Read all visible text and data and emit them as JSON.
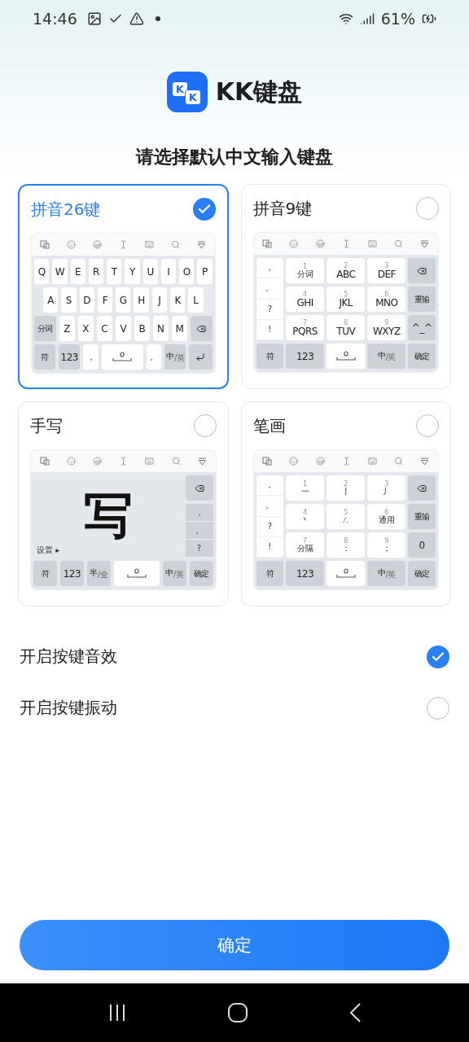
{
  "status_bar": {
    "time": "14:46",
    "battery": "61%"
  },
  "brand": {
    "logo_letters": [
      "K",
      "K"
    ],
    "name": "KK键盘"
  },
  "heading": "请选择默认中文输入键盘",
  "keyboards": [
    {
      "title": "拼音26键",
      "selected": true,
      "kind": "qwerty",
      "key_rows": [
        {
          "keys": [
            {
              "kind": "letter",
              "label": "Q"
            },
            {
              "kind": "letter",
              "label": "W"
            },
            {
              "kind": "letter",
              "label": "E"
            },
            {
              "kind": "letter",
              "label": "R"
            },
            {
              "kind": "letter",
              "label": "T"
            },
            {
              "kind": "letter",
              "label": "Y"
            },
            {
              "kind": "letter",
              "label": "U"
            },
            {
              "kind": "letter",
              "label": "I"
            },
            {
              "kind": "letter",
              "label": "O"
            },
            {
              "kind": "letter",
              "label": "P"
            }
          ]
        },
        {
          "keys": [
            {
              "kind": "letter",
              "label": "A"
            },
            {
              "kind": "letter",
              "label": "S"
            },
            {
              "kind": "letter",
              "label": "D"
            },
            {
              "kind": "letter",
              "label": "F"
            },
            {
              "kind": "letter",
              "label": "G"
            },
            {
              "kind": "letter",
              "label": "H"
            },
            {
              "kind": "letter",
              "label": "J"
            },
            {
              "kind": "letter",
              "label": "K"
            },
            {
              "kind": "letter",
              "label": "L"
            }
          ]
        },
        {
          "keys": [
            {
              "kind": "func",
              "label": "分词"
            },
            {
              "kind": "letter",
              "label": "Z"
            },
            {
              "kind": "letter",
              "label": "X"
            },
            {
              "kind": "letter",
              "label": "C"
            },
            {
              "kind": "letter",
              "label": "V"
            },
            {
              "kind": "letter",
              "label": "B"
            },
            {
              "kind": "letter",
              "label": "N"
            },
            {
              "kind": "letter",
              "label": "M"
            },
            {
              "kind": "backspace"
            }
          ]
        },
        {
          "keys": [
            {
              "kind": "func",
              "label": "符"
            },
            {
              "kind": "func",
              "label": "123"
            },
            {
              "kind": "letter",
              "label": "，"
            },
            {
              "kind": "space"
            },
            {
              "kind": "letter",
              "label": "。"
            },
            {
              "kind": "func",
              "label": "中$_{/英}$"
            },
            {
              "kind": "enter"
            }
          ]
        }
      ]
    },
    {
      "title": "拼音9键",
      "selected": false,
      "kind": "grid",
      "side": [
        "，",
        "。",
        "?",
        "!"
      ],
      "keys": [
        {
          "kind": "letter",
          "label": "分词",
          "hint": "1"
        },
        {
          "kind": "letter",
          "label": "ABC",
          "hint": "2"
        },
        {
          "kind": "letter",
          "label": "DEF",
          "hint": "3"
        },
        {
          "kind": "letter",
          "label": "GHI",
          "hint": "4"
        },
        {
          "kind": "letter",
          "label": "JKL",
          "hint": "5"
        },
        {
          "kind": "letter",
          "label": "MNO",
          "hint": "6"
        },
        {
          "kind": "letter",
          "label": "PQRS",
          "hint": "7"
        },
        {
          "kind": "letter",
          "label": "TUV",
          "hint": "8"
        },
        {
          "kind": "letter",
          "label": "WXYZ",
          "hint": "9"
        }
      ],
      "right": [
        {
          "kind": "backspace"
        },
        {
          "kind": "func",
          "label": "重输"
        },
        {
          "kind": "func",
          "label": "^_^"
        }
      ],
      "bottom": [
        {
          "kind": "func",
          "label": "符"
        },
        {
          "kind": "func",
          "label": "123"
        },
        {
          "kind": "space"
        },
        {
          "kind": "func",
          "label": "中$_{/英}$"
        },
        {
          "kind": "func",
          "label": "确定"
        }
      ]
    },
    {
      "title": "手写",
      "selected": false,
      "kind": "handwriting",
      "ink": "写",
      "settings": "设置 ▸",
      "side": [
        "，",
        "。",
        "?"
      ],
      "top_right": {
        "kind": "backspace"
      },
      "bottom": [
        {
          "kind": "func",
          "label": "符"
        },
        {
          "kind": "func",
          "label": "123"
        },
        {
          "kind": "func",
          "label": "半$_{/全}$"
        },
        {
          "kind": "space"
        },
        {
          "kind": "func",
          "label": "中$_{/英}$"
        },
        {
          "kind": "func",
          "label": "确定"
        }
      ]
    },
    {
      "title": "笔画",
      "selected": false,
      "kind": "grid",
      "side": [
        "，",
        "。",
        "?",
        "!"
      ],
      "keys": [
        {
          "kind": "letter",
          "label": "一",
          "hint": "1"
        },
        {
          "kind": "letter",
          "label": "丨",
          "hint": "2"
        },
        {
          "kind": "letter",
          "label": "丿",
          "hint": "3"
        },
        {
          "kind": "letter",
          "label": "丶",
          "hint": "4"
        },
        {
          "kind": "letter",
          "label": "ㄥ",
          "hint": "5"
        },
        {
          "kind": "letter",
          "label": "通用",
          "hint": "6"
        },
        {
          "kind": "letter",
          "label": "分隔",
          "hint": "7"
        },
        {
          "kind": "letter",
          "label": "：",
          "hint": "8"
        },
        {
          "kind": "letter",
          "label": "；",
          "hint": "9"
        }
      ],
      "right": [
        {
          "kind": "backspace"
        },
        {
          "kind": "func",
          "label": "重输"
        },
        {
          "kind": "func",
          "label": "0"
        }
      ],
      "bottom": [
        {
          "kind": "func",
          "label": "符"
        },
        {
          "kind": "func",
          "label": "123"
        },
        {
          "kind": "space"
        },
        {
          "kind": "func",
          "label": "中$_{/英}$"
        },
        {
          "kind": "func",
          "label": "确定"
        }
      ]
    }
  ],
  "options": [
    {
      "label": "开启按键音效",
      "checked": true
    },
    {
      "label": "开启按键振动",
      "checked": false
    }
  ],
  "confirm": "确定"
}
